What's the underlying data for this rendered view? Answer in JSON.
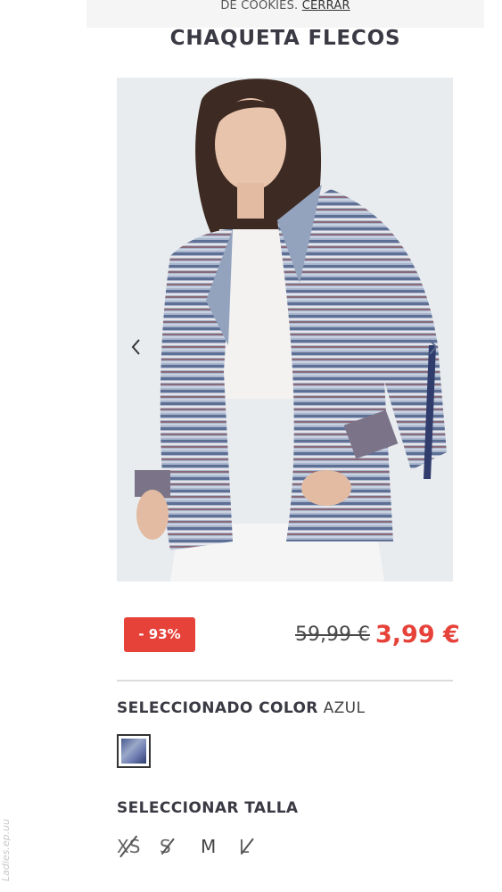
{
  "cookie_bar": {
    "text": "DE COOKIES.",
    "close_label": "CERRAR"
  },
  "product": {
    "title": "CHAQUETA FLECOS",
    "discount_badge": "- 93%",
    "old_price": "59,99 €",
    "price": "3,99 €"
  },
  "gallery": {
    "prev_icon": "chevron-left-icon",
    "next_icon": "chevron-right-icon"
  },
  "color": {
    "label": "SELECCIONADO COLOR",
    "value": "AZUL",
    "swatch_name": "azul-swatch"
  },
  "size": {
    "label": "SELECCIONAR TALLA",
    "options": [
      {
        "label": "XS",
        "available": false
      },
      {
        "label": "S",
        "available": false
      },
      {
        "label": "M",
        "available": true
      },
      {
        "label": "L",
        "available": false
      }
    ]
  },
  "watermark": {
    "text": "Ladies.ep.uu"
  },
  "colors": {
    "accent": "#e6423a",
    "text": "#3a3a44",
    "divider": "#dcdcdc"
  }
}
